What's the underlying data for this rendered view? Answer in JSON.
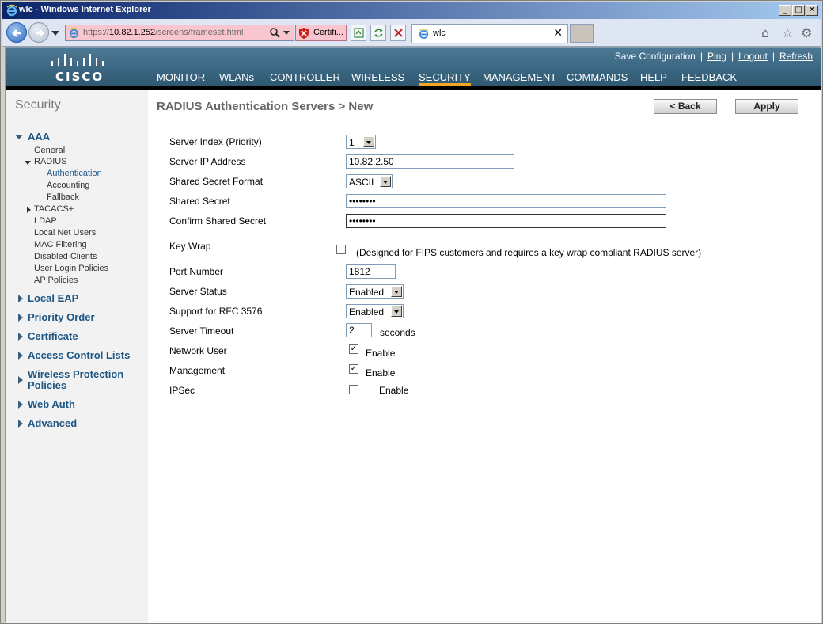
{
  "window": {
    "title": "wlc - Windows Internet Explorer",
    "minimize": "_",
    "maximize": "□",
    "close": "✕"
  },
  "browser": {
    "url_prefix": "https://",
    "url_host": "10.82.1.252",
    "url_path": "/screens/frameset.html",
    "cert_label": "Certifi...",
    "tab_title": "wlc",
    "tab_close": "✕"
  },
  "header": {
    "logo": "CISCO",
    "links": [
      "Save Configuration",
      "Ping",
      "Logout",
      "Refresh"
    ],
    "menu": [
      "MONITOR",
      "WLANs",
      "CONTROLLER",
      "WIRELESS",
      "SECURITY",
      "MANAGEMENT",
      "COMMANDS",
      "HELP",
      "FEEDBACK"
    ],
    "active_menu": "SECURITY"
  },
  "sidebar": {
    "title": "Security",
    "aaa": "AAA",
    "aaa_items": [
      "General",
      "RADIUS",
      "TACACS+",
      "LDAP",
      "Local Net Users",
      "MAC Filtering",
      "Disabled Clients",
      "User Login Policies",
      "AP Policies"
    ],
    "radius_items": [
      "Authentication",
      "Accounting",
      "Fallback"
    ],
    "sections": [
      "Local EAP",
      "Priority Order",
      "Certificate",
      "Access Control Lists",
      "Wireless Protection",
      "Policies",
      "Web Auth",
      "Advanced"
    ]
  },
  "main": {
    "title": "RADIUS Authentication Servers > New",
    "back_button": "< Back",
    "apply_button": "Apply",
    "fields": {
      "server_index_label": "Server Index (Priority)",
      "server_index_value": "1",
      "server_ip_label": "Server IP Address",
      "server_ip_value": "10.82.2.50",
      "secret_format_label": "Shared Secret Format",
      "secret_format_value": "ASCII",
      "secret_label": "Shared Secret",
      "secret_value": "••••••••",
      "confirm_secret_label": "Confirm Shared Secret",
      "confirm_secret_value": "••••••••",
      "key_wrap_label": "Key Wrap",
      "key_wrap_note": "(Designed for FIPS customers and requires a key wrap compliant RADIUS server)",
      "port_label": "Port Number",
      "port_value": "1812",
      "status_label": "Server Status",
      "status_value": "Enabled",
      "rfc_label": "Support for RFC 3576",
      "rfc_value": "Enabled",
      "timeout_label": "Server Timeout",
      "timeout_value": "2",
      "timeout_unit": "seconds",
      "network_user_label": "Network User",
      "network_user_enable": "Enable",
      "management_label": "Management",
      "management_enable": "Enable",
      "ipsec_label": "IPSec",
      "ipsec_enable": "Enable"
    },
    "checks": {
      "key_wrap": false,
      "network_user": true,
      "management": true,
      "ipsec": false
    }
  }
}
